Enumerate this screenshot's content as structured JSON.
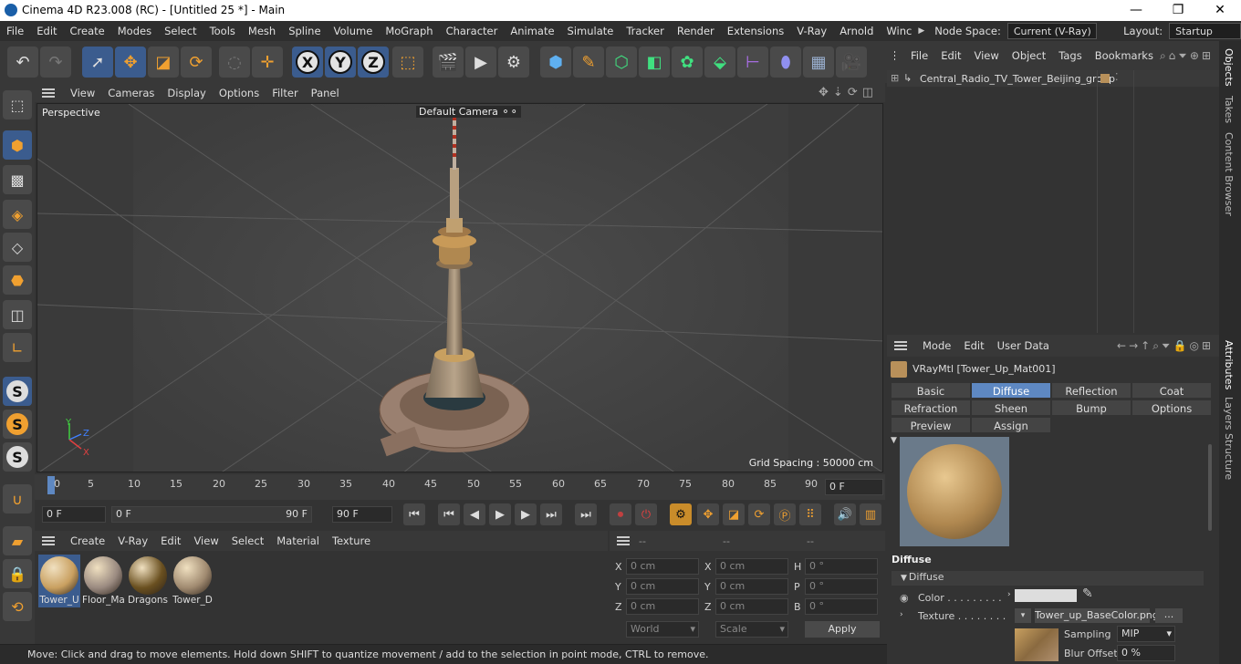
{
  "window": {
    "title": "Cinema 4D R23.008 (RC) - [Untitled 25 *] - Main",
    "minimize": "—",
    "maximize": "❐",
    "close": "✕"
  },
  "menu": {
    "items": [
      "File",
      "Edit",
      "Create",
      "Modes",
      "Select",
      "Tools",
      "Mesh",
      "Spline",
      "Volume",
      "MoGraph",
      "Character",
      "Animate",
      "Simulate",
      "Tracker",
      "Render",
      "Extensions",
      "V-Ray",
      "Arnold",
      "Winc"
    ],
    "node_space_label": "Node Space:",
    "node_space_value": "Current (V-Ray)",
    "layout_label": "Layout:",
    "layout_value": "Startup"
  },
  "viewport": {
    "menu": [
      "View",
      "Cameras",
      "Display",
      "Options",
      "Filter",
      "Panel"
    ],
    "name": "Perspective",
    "camera": "Default Camera",
    "grid_spacing": "Grid Spacing : 50000 cm"
  },
  "timeline": {
    "ticks": [
      "0",
      "5",
      "10",
      "15",
      "20",
      "25",
      "30",
      "35",
      "40",
      "45",
      "50",
      "55",
      "60",
      "65",
      "70",
      "75",
      "80",
      "85",
      "90"
    ],
    "current_frame": "0 F"
  },
  "transport": {
    "start": "0 F",
    "range_start": "0 F",
    "range_end": "90 F",
    "end": "90 F"
  },
  "material_manager": {
    "menu": [
      "Create",
      "V-Ray",
      "Edit",
      "View",
      "Select",
      "Material",
      "Texture"
    ],
    "materials": [
      {
        "name": "Tower_U",
        "color": "#c9a060"
      },
      {
        "name": "Floor_Ma",
        "color": "#9a8a80"
      },
      {
        "name": "Dragons",
        "color": "#6a5020"
      },
      {
        "name": "Tower_D",
        "color": "#a08a70"
      }
    ]
  },
  "coordinates": {
    "header": [
      "--",
      "--",
      "--"
    ],
    "rows": [
      {
        "a": "X",
        "av": "0 cm",
        "b": "X",
        "bv": "0 cm",
        "c": "H",
        "cv": "0 °"
      },
      {
        "a": "Y",
        "av": "0 cm",
        "b": "Y",
        "bv": "0 cm",
        "c": "P",
        "cv": "0 °"
      },
      {
        "a": "Z",
        "av": "0 cm",
        "b": "Z",
        "bv": "0 cm",
        "c": "B",
        "cv": "0 °"
      }
    ],
    "mode1": "World",
    "mode2": "Scale",
    "apply": "Apply"
  },
  "status": "Move: Click and drag to move elements. Hold down SHIFT to quantize movement / add to the selection in point mode, CTRL to remove.",
  "object_manager": {
    "menu": [
      "File",
      "Edit",
      "View",
      "Object",
      "Tags",
      "Bookmarks"
    ],
    "objects": [
      "Central_Radio_TV_Tower_Beijing_group"
    ]
  },
  "attributes": {
    "menu": [
      "Mode",
      "Edit",
      "User Data"
    ],
    "material_title": "VRayMtl [Tower_Up_Mat001]",
    "tabs_row1": [
      "Basic",
      "Diffuse",
      "Reflection",
      "Coat"
    ],
    "tabs_row2": [
      "Refraction",
      "Sheen",
      "Bump",
      "Options"
    ],
    "tabs_row3": [
      "Preview Settings",
      "Assign"
    ],
    "section": "Diffuse",
    "group": "Diffuse",
    "color_label": "Color . . . . . . . . .",
    "texture_label": "Texture . . . . . . . .",
    "texture_file": "Tower_up_BaseColor.png",
    "texture_more": "...",
    "sampling_label": "Sampling",
    "sampling_value": "MIP",
    "blur_label": "Blur Offset",
    "blur_value": "0 %"
  },
  "side_tabs": [
    "Objects",
    "Takes",
    "Content Browser",
    "Attributes",
    "Layers",
    "Structure"
  ],
  "colors": {
    "accent": "#5e88c2",
    "selected_tool": "#3b5c8e",
    "orange": "#c98c2a"
  }
}
